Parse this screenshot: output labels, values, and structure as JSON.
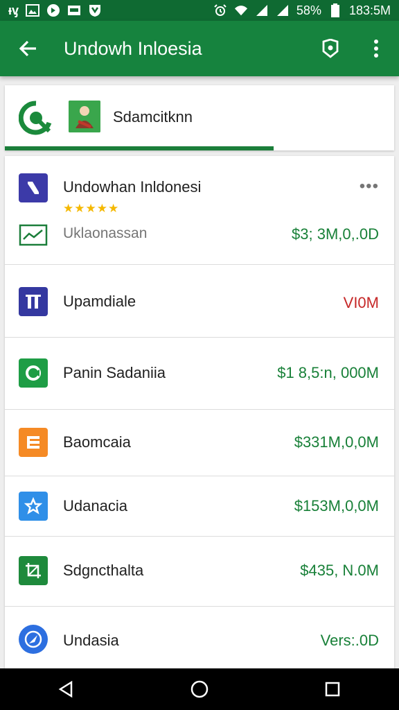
{
  "status_bar": {
    "left_text": "ᵻᶌ",
    "battery": "58%",
    "time": "183:5M",
    "icons": [
      "notification-icon",
      "image-icon",
      "circle-badge-icon",
      "mail-icon",
      "shield-icon",
      "alarm-icon",
      "wifi-icon",
      "signal-icon",
      "battery-icon"
    ]
  },
  "app_bar": {
    "title": "Undowh Inloesia",
    "icons": [
      "back-arrow-icon",
      "map-pin-icon",
      "more-vert-icon"
    ]
  },
  "top_card": {
    "title": "Sdamcitknn",
    "progress": 0.69,
    "icons": [
      "search-logo-icon",
      "thumbnail-image"
    ]
  },
  "list": {
    "featured": {
      "name": "Undowhan Inldonesi",
      "stars": "★★★★★",
      "sub_label": "Uklaonassan",
      "amount": "$3; 3M,0,.0D",
      "more": "•••",
      "icon": "brand-n-icon",
      "sub_icon": "trend-chart-icon"
    },
    "rows": [
      {
        "name": "Upamdiale",
        "amount": "VI0M",
        "icon": "pillars-icon",
        "color": "#3949ab",
        "amount_color": "red"
      },
      {
        "name": "Panin Sadaniia",
        "amount": "$1 8,5:n, 000M",
        "icon": "ring-icon",
        "color": "#1e9d45",
        "amount_color": "green"
      },
      {
        "name": "Baomcaia",
        "amount": "$331M,0,0M",
        "icon": "b-bars-icon",
        "color": "#f58a25",
        "amount_color": "green"
      },
      {
        "name": "Udanacia",
        "amount": "$153M,0,0M",
        "icon": "star-tag-icon",
        "color": "#2f8fe8",
        "amount_color": "green"
      },
      {
        "name": "Sdgncthalta",
        "amount": "$435, N.0M",
        "icon": "crop-icon",
        "color": "#1e8a3c",
        "amount_color": "green"
      },
      {
        "name": "Undasia",
        "amount": "Vers:.0D",
        "icon": "compass-arrow-icon",
        "color": "#2d6fe0",
        "amount_color": "green"
      }
    ]
  },
  "nav_bar": {
    "icons": [
      "back-triangle-icon",
      "home-circle-icon",
      "recents-square-icon"
    ]
  }
}
